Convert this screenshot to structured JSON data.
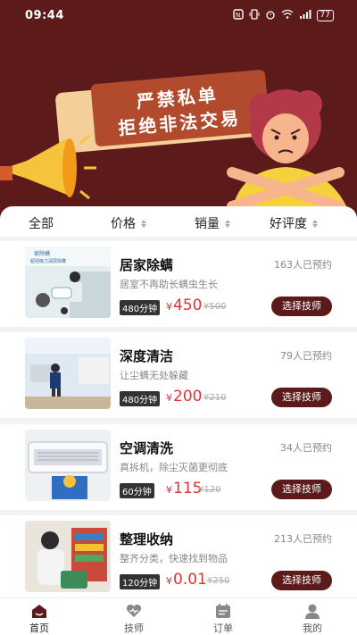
{
  "status_bar": {
    "time": "09:44",
    "icons": [
      "nfc-icon",
      "vibrate-icon",
      "alarm-icon",
      "wifi-icon",
      "signal-icon"
    ],
    "battery": "77"
  },
  "banner": {
    "line1": "严禁私单",
    "line2": "拒绝非法交易"
  },
  "filters": [
    {
      "label": "全部",
      "sortable": false
    },
    {
      "label": "价格",
      "sortable": true
    },
    {
      "label": "销量",
      "sortable": true
    },
    {
      "label": "好评度",
      "sortable": true
    }
  ],
  "services": [
    {
      "title": "居家除螨",
      "desc": "居室不再助长螨虫生长",
      "booked": "163人已预约",
      "duration": "480分钟",
      "price": "450",
      "old_price": "¥500",
      "button": "选择技师",
      "thumb_caption_1": "家除螨",
      "thumb_caption_2": "超强吸力深层除螨"
    },
    {
      "title": "深度清洁",
      "desc": "让尘螨无处躲藏",
      "booked": "79人已预约",
      "duration": "480分钟",
      "price": "200",
      "old_price": "¥210",
      "button": "选择技师",
      "thumb_caption_1": "",
      "thumb_caption_2": ""
    },
    {
      "title": "空调清洗",
      "desc": "真拆机，除尘灭菌更彻底",
      "booked": "34人已预约",
      "duration": "60分钟",
      "price": "115",
      "old_price": "¥120",
      "button": "选择技师",
      "thumb_caption_1": "",
      "thumb_caption_2": ""
    },
    {
      "title": "整理收纳",
      "desc": "整齐分类，快速找到物品",
      "booked": "213人已预约",
      "duration": "120分钟",
      "price": "0.01",
      "old_price": "¥250",
      "button": "选择技师",
      "thumb_caption_1": "",
      "thumb_caption_2": ""
    }
  ],
  "currency": "¥",
  "nav": [
    {
      "label": "首页",
      "icon": "home-icon",
      "active": true
    },
    {
      "label": "技师",
      "icon": "heart-icon",
      "active": false
    },
    {
      "label": "订单",
      "icon": "calendar-icon",
      "active": false
    },
    {
      "label": "我的",
      "icon": "user-icon",
      "active": false
    }
  ],
  "colors": {
    "brand": "#5c1a1b",
    "price": "#d33333",
    "banner_accent": "#f5cf9a"
  }
}
